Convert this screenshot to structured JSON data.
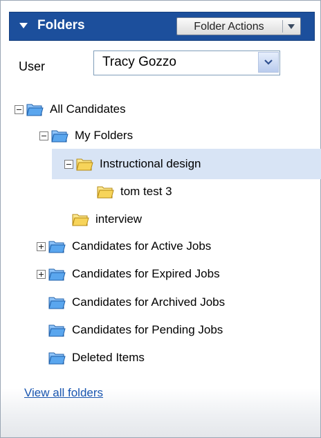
{
  "header": {
    "title": "Folders",
    "actions_label": "Folder Actions"
  },
  "user": {
    "label": "User",
    "selected": "Tracy Gozzo"
  },
  "tree": [
    {
      "id": "all-candidates",
      "label": "All Candidates",
      "icon": "blue-folder-icon",
      "toggle": "minus"
    },
    {
      "id": "my-folders",
      "label": "My Folders",
      "icon": "blue-folder-icon",
      "toggle": "minus"
    },
    {
      "id": "instructional-design",
      "label": "Instructional design",
      "icon": "yellow-folder-icon",
      "toggle": "minus",
      "selected": true
    },
    {
      "id": "tom-test-3",
      "label": "tom test 3",
      "icon": "yellow-folder-icon",
      "toggle": "none"
    },
    {
      "id": "interview",
      "label": "interview",
      "icon": "yellow-folder-icon",
      "toggle": "none"
    },
    {
      "id": "active-jobs",
      "label": "Candidates for Active Jobs",
      "icon": "blue-folder-icon",
      "toggle": "plus"
    },
    {
      "id": "expired-jobs",
      "label": "Candidates for Expired Jobs",
      "icon": "blue-folder-icon",
      "toggle": "plus"
    },
    {
      "id": "archived-jobs",
      "label": "Candidates for Archived Jobs",
      "icon": "blue-folder-icon",
      "toggle": "none"
    },
    {
      "id": "pending-jobs",
      "label": "Candidates for Pending Jobs",
      "icon": "blue-folder-icon",
      "toggle": "none"
    },
    {
      "id": "deleted-items",
      "label": "Deleted Items",
      "icon": "blue-folder-icon",
      "toggle": "none"
    }
  ],
  "footer": {
    "link_label": "View all folders"
  },
  "colors": {
    "header_bg": "#1c4f9c",
    "selected_bg": "#d8e4f5",
    "link": "#1a56b0",
    "blue_folder": "#3d8fde",
    "yellow_folder": "#f5c93c"
  }
}
